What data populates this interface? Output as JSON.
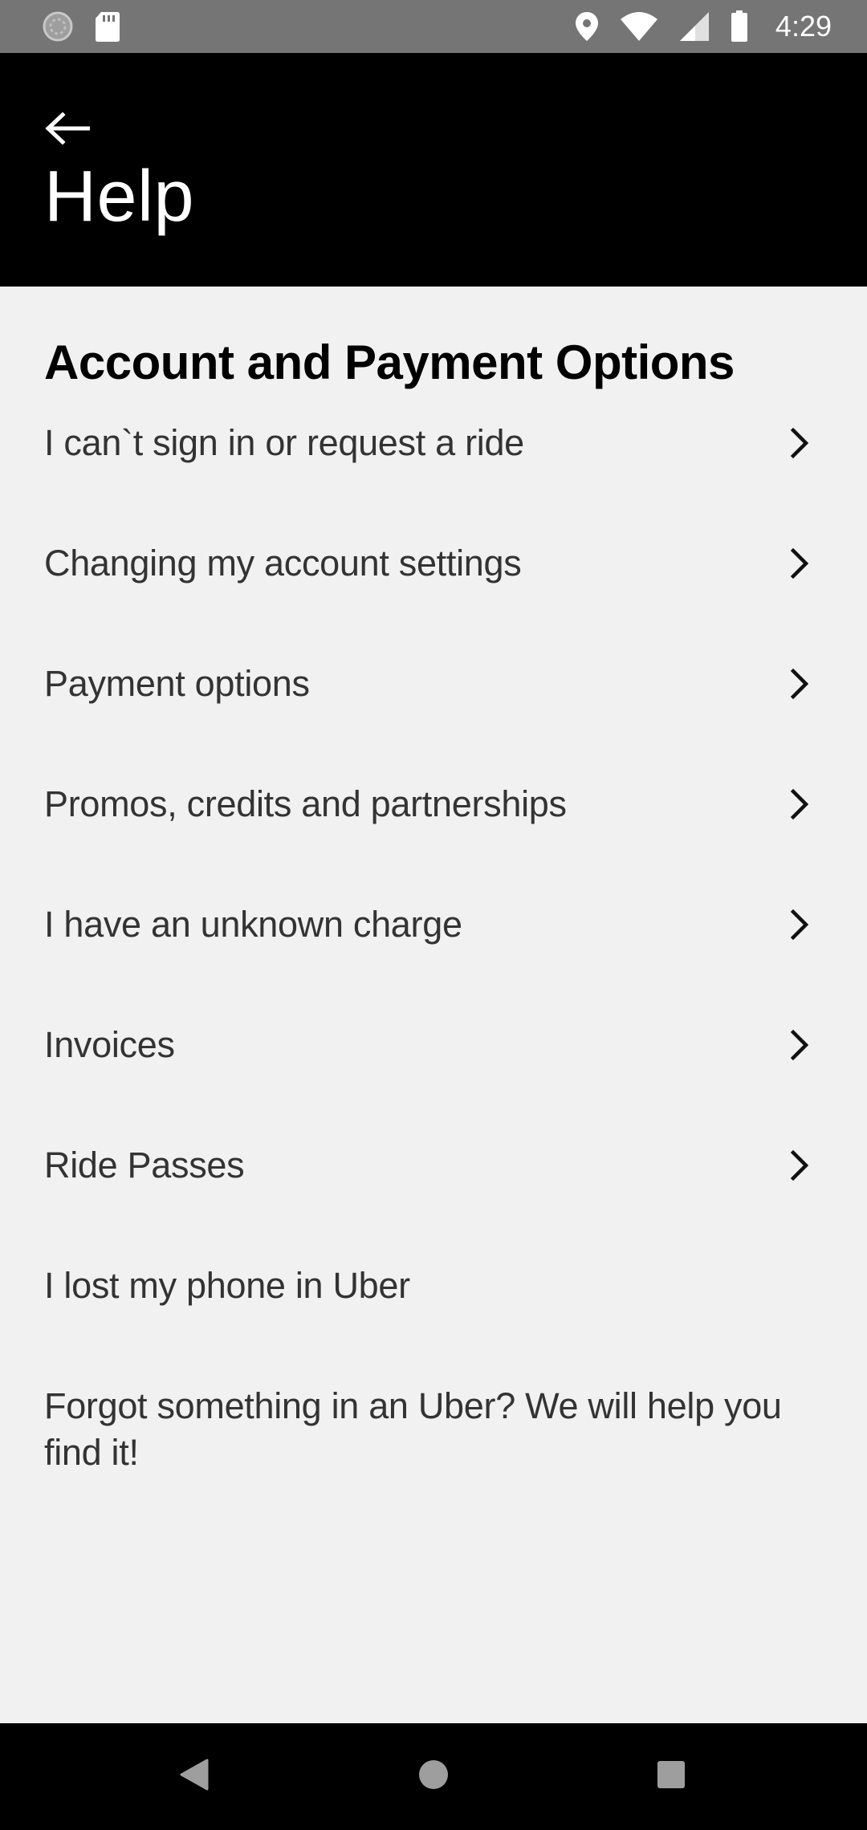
{
  "status_bar": {
    "time": "4:29",
    "left_icons": [
      "loading-icon",
      "sd-card-icon"
    ],
    "right_icons": [
      "location-icon",
      "wifi-icon",
      "signal-icon",
      "battery-icon"
    ]
  },
  "header": {
    "back_icon": "arrow-left-icon",
    "title": "Help"
  },
  "section": {
    "title": "Account and Payment Options"
  },
  "items": [
    {
      "label": "I can`t sign in or request a ride",
      "has_chevron": true
    },
    {
      "label": "Changing my account settings",
      "has_chevron": true
    },
    {
      "label": "Payment options",
      "has_chevron": true
    },
    {
      "label": "Promos, credits and partnerships",
      "has_chevron": true
    },
    {
      "label": "I have an unknown charge",
      "has_chevron": true
    },
    {
      "label": "Invoices",
      "has_chevron": true
    },
    {
      "label": "Ride Passes",
      "has_chevron": true
    },
    {
      "label": "I lost my phone in Uber",
      "has_chevron": false
    },
    {
      "label": "Forgot something in an Uber? We will help you find it!",
      "has_chevron": false
    }
  ],
  "nav_bar": {
    "icons": [
      "back-triangle-icon",
      "home-circle-icon",
      "recents-square-icon"
    ]
  },
  "colors": {
    "status_bar_bg": "#757575",
    "header_bg": "#000000",
    "content_bg": "#f1f1f1",
    "item_text": "#333333"
  }
}
